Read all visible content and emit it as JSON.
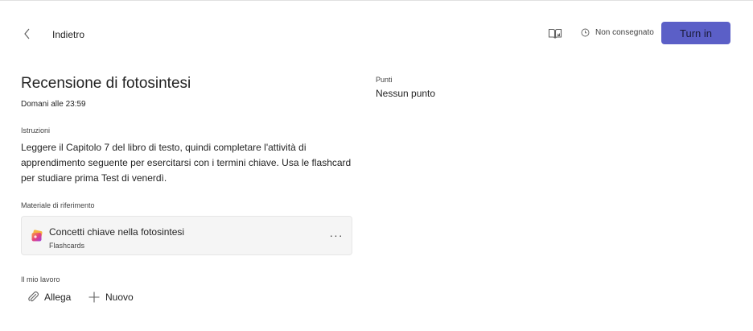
{
  "header": {
    "back_label": "Indietro",
    "status_text": "Non consegnato",
    "turn_in_label": "Turn in"
  },
  "assignment": {
    "title": "Recensione di fotosintesi",
    "due": "Domani alle 23:59",
    "instructions_label": "Istruzioni",
    "instructions_text": "Leggere il Capitolo 7 del libro di testo, quindi completare l'attività di apprendimento seguente per esercitarsi con i termini chiave. Usa le flashcard per studiare prima Test di venerdì.",
    "reference_label": "Materiale di riferimento",
    "reference": {
      "title": "Concetti chiave nella fotosintesi",
      "subtitle": "Flashcards",
      "more_label": "···"
    },
    "my_work_label": "Il mio lavoro",
    "attach_label": "Allega",
    "new_label": "Nuovo"
  },
  "points": {
    "label": "Punti",
    "value": "Nessun punto"
  },
  "colors": {
    "accent": "#5b5fc7",
    "card_bg": "#f5f5f5"
  },
  "icons": [
    "chevron-left-icon",
    "immersive-reader-icon",
    "clock-icon",
    "flashcards-icon",
    "paperclip-icon",
    "plus-icon"
  ]
}
